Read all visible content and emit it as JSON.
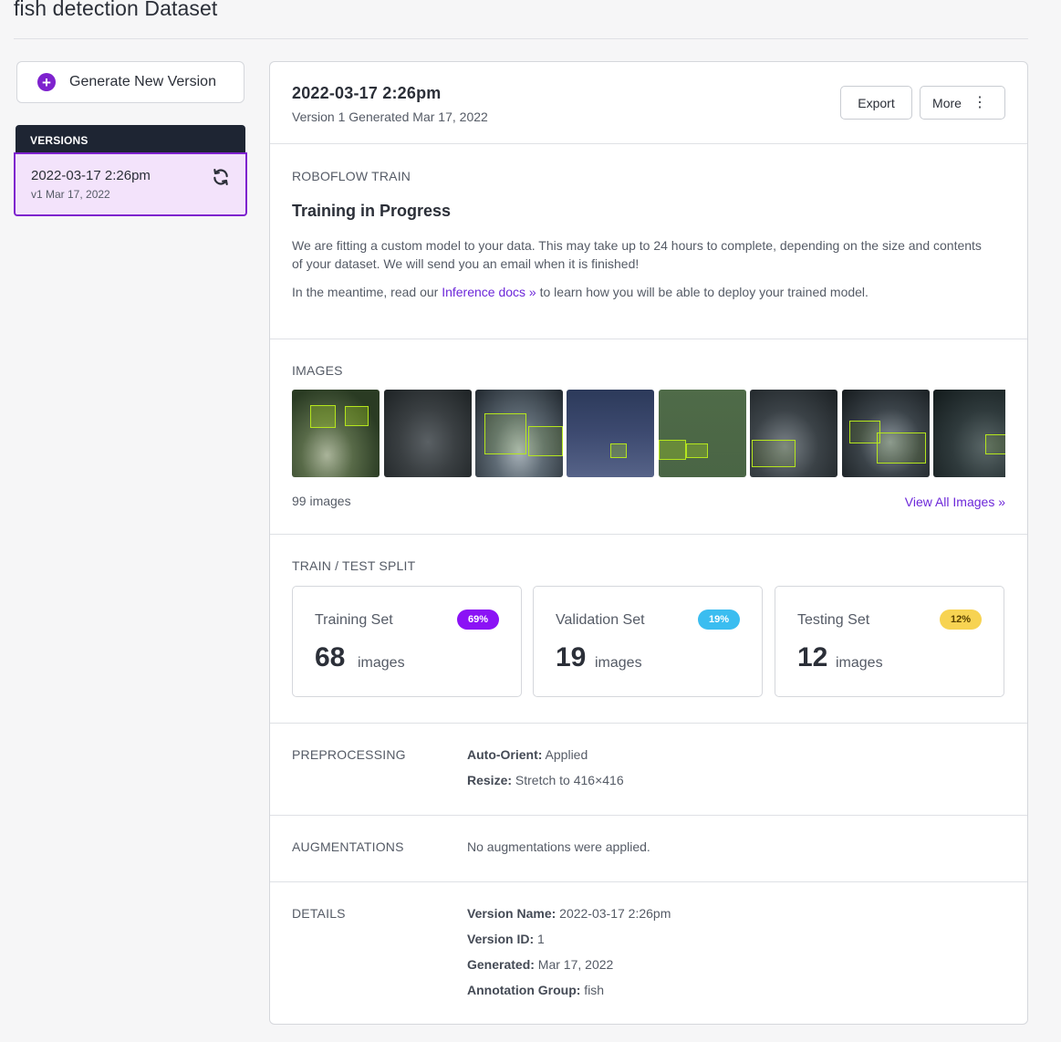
{
  "page": {
    "title": "fish detection Dataset"
  },
  "sidebar": {
    "generate_label": "Generate New Version",
    "versions_heading": "VERSIONS",
    "versions": [
      {
        "title": "2022-03-17 2:26pm",
        "subtitle": "v1 Mar 17, 2022"
      }
    ]
  },
  "header": {
    "version_title": "2022-03-17 2:26pm",
    "version_subtitle": "Version 1 Generated Mar 17, 2022",
    "export_label": "Export",
    "more_label": "More"
  },
  "train": {
    "eyebrow": "ROBOFLOW TRAIN",
    "heading": "Training in Progress",
    "paragraph": "We are fitting a custom model to your data. This may take up to 24 hours to complete, depending on the size and contents of your dataset. We will send you an email when it is finished!",
    "meantime_prefix": "In the meantime, read our ",
    "docs_link": "Inference docs »",
    "meantime_suffix": " to learn how you will be able to deploy your trained model."
  },
  "images": {
    "eyebrow": "IMAGES",
    "count": "99 images",
    "view_all": "View All Images »"
  },
  "split": {
    "eyebrow": "TRAIN / TEST SPLIT",
    "sets": [
      {
        "name": "Training Set",
        "percent": "69%",
        "count": "68",
        "unit": "images",
        "badge_bg": "#8b12f5",
        "badge_fg": "#ffffff"
      },
      {
        "name": "Validation Set",
        "percent": "19%",
        "count": "19",
        "unit": "images",
        "badge_bg": "#3bbdf0",
        "badge_fg": "#ffffff"
      },
      {
        "name": "Testing Set",
        "percent": "12%",
        "count": "12",
        "unit": "images",
        "badge_bg": "#f7d352",
        "badge_fg": "#5a4200"
      }
    ]
  },
  "preprocessing": {
    "eyebrow": "PREPROCESSING",
    "items": [
      {
        "label": "Auto-Orient:",
        "value": " Applied"
      },
      {
        "label": "Resize:",
        "value": " Stretch to 416×416"
      }
    ]
  },
  "augmentations": {
    "eyebrow": "AUGMENTATIONS",
    "text": "No augmentations were applied."
  },
  "details": {
    "eyebrow": "DETAILS",
    "items": [
      {
        "label": "Version Name:",
        "value": " 2022-03-17 2:26pm"
      },
      {
        "label": "Version ID:",
        "value": " 1"
      },
      {
        "label": "Generated:",
        "value": " Mar 17, 2022"
      },
      {
        "label": "Annotation Group:",
        "value": " fish"
      }
    ]
  },
  "colors": {
    "accent": "#7e22ce",
    "link": "#6d28d9",
    "sidebar_dark": "#1e2533",
    "selected_bg": "#f3e3fb"
  }
}
